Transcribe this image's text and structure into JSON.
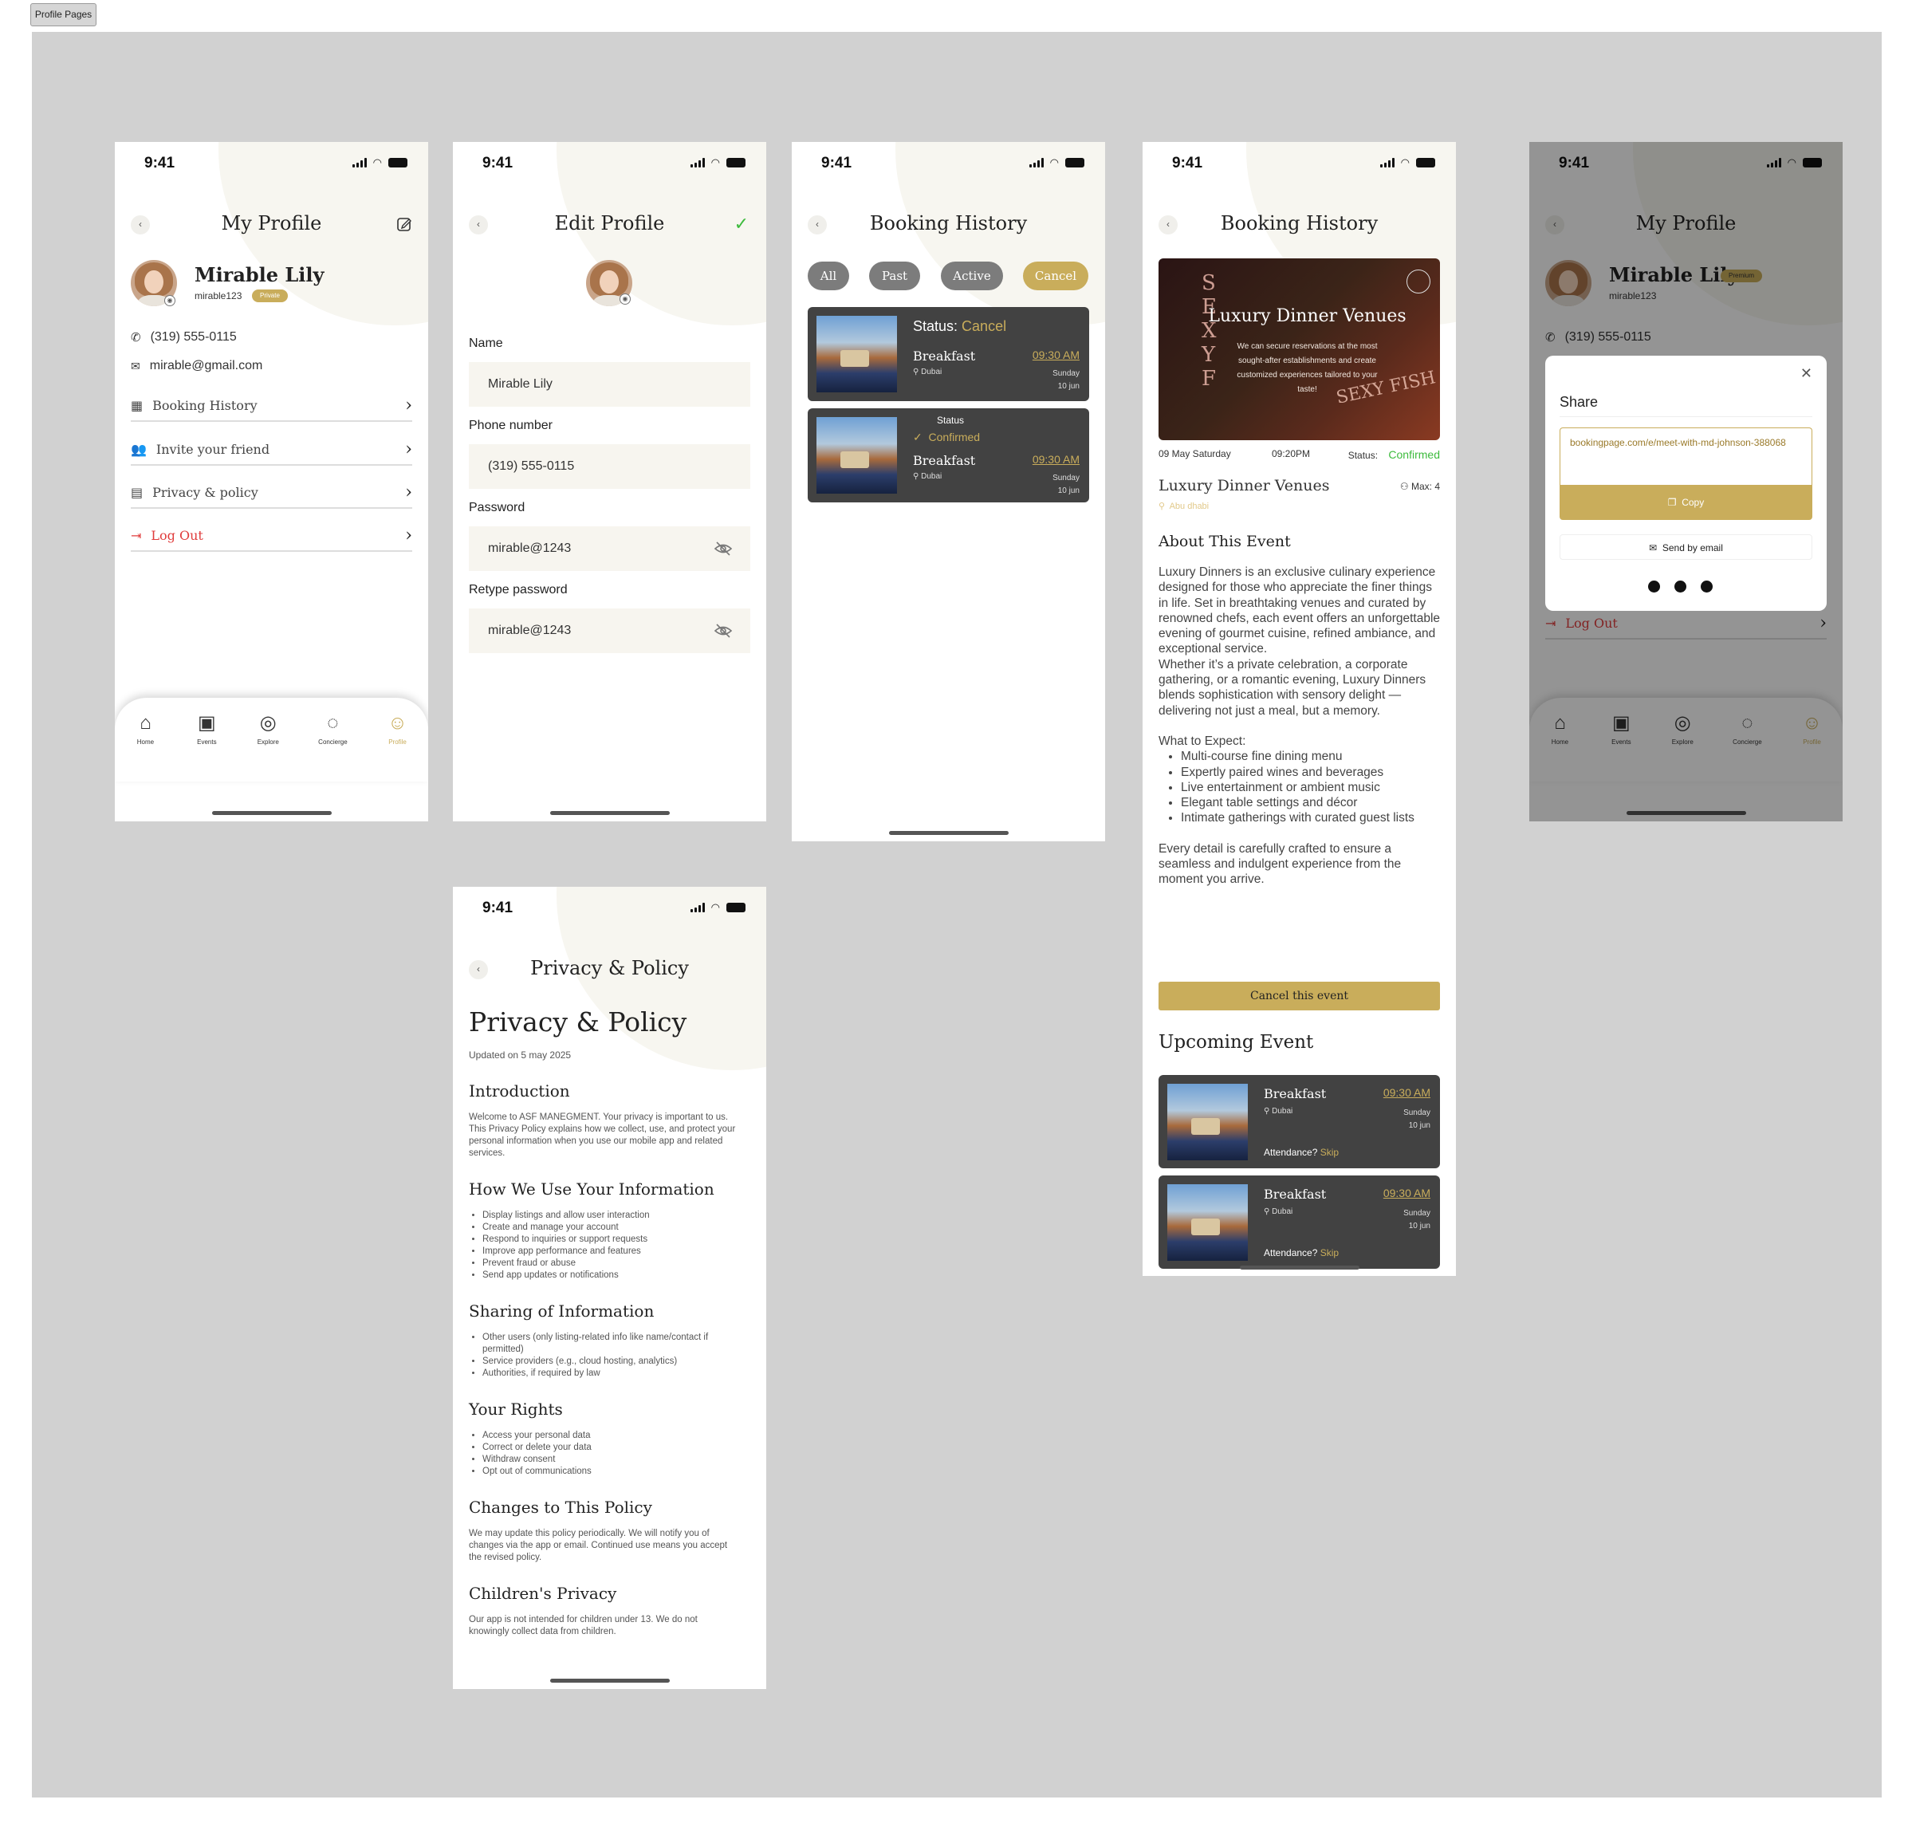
{
  "page_label": "Profile Pages",
  "status_time": "9:41",
  "accent": "#c9ad5b",
  "nav": {
    "home": "Home",
    "events": "Events",
    "explore": "Explore",
    "concierge": "Concierge",
    "profile": "Profile"
  },
  "my_profile": {
    "title": "My Profile",
    "name": "Mirable Lily",
    "username": "mirable123",
    "badge": "Private",
    "phone": "(319) 555-0115",
    "email": "mirable@gmail.com",
    "menu": [
      {
        "label": "Booking History",
        "icon": "calendar-icon"
      },
      {
        "label": "Invite your friend",
        "icon": "add-user-icon"
      },
      {
        "label": "Privacy & policy",
        "icon": "document-icon"
      },
      {
        "label": "Log Out",
        "icon": "logout-icon",
        "color": "#e03c3c"
      }
    ]
  },
  "edit_profile": {
    "title": "Edit Profile",
    "name_label": "Name",
    "name_value": "Mirable Lily",
    "phone_label": "Phone number",
    "phone_value": "(319) 555-0115",
    "password_label": "Password",
    "password_value": "mirable@1243",
    "retype_label": "Retype password",
    "retype_value": "mirable@1243"
  },
  "booking_list": {
    "title": "Booking History",
    "filters": [
      "All",
      "Past",
      "Active",
      "Cancel"
    ],
    "active_filter": "Cancel",
    "cards": [
      {
        "status_label": "Status:",
        "status": "Cancel",
        "title": "Breakfast",
        "location": "Dubai",
        "time": "09:30 AM",
        "day": "Sunday",
        "date": "10 jun"
      },
      {
        "status_label": "Status",
        "status": "Confirmed",
        "title": "Breakfast",
        "location": "Dubai",
        "time": "09:30 AM",
        "day": "Sunday",
        "date": "10 jun"
      }
    ]
  },
  "booking_detail": {
    "title": "Booking History",
    "hero_title": "Luxury Dinner Venues",
    "hero_sub": "We can secure reservations at the most sought-after establishments and create customized experiences tailored to your taste!",
    "hero_sign_left": "SEXY F",
    "hero_sign_right": "SEXY FISH",
    "date": "09 May Saturday",
    "time": "09:20PM",
    "status_label": "Status:",
    "status": "Confirmed",
    "venue": "Luxury Dinner Venues",
    "max": "Max: 4",
    "location": "Abu dhabi",
    "about_title": "About This Event",
    "about_p1": "Luxury Dinners is an exclusive culinary experience designed for those who appreciate the finer things in life. Set in breathtaking venues and curated by renowned chefs, each event offers an unforgettable evening of gourmet cuisine, refined ambiance, and exceptional service.",
    "about_p2": "Whether it’s a private celebration, a corporate gathering, or a romantic evening, Luxury Dinners blends sophistication with sensory delight — delivering not just a meal, but a memory.",
    "expect_title": "What to Expect:",
    "expect": [
      "Multi-course fine dining menu",
      "Expertly paired wines and beverages",
      "Live entertainment or ambient music",
      "Elegant table settings and décor",
      "Intimate gatherings with curated guest lists"
    ],
    "closing": "Every detail is carefully crafted to ensure a seamless and indulgent experience from the moment you arrive.",
    "cancel_button": "Cancel this event",
    "upcoming_title": "Upcoming Event",
    "upcoming": [
      {
        "title": "Breakfast",
        "location": "Dubai",
        "time": "09:30 AM",
        "day": "Sunday",
        "date": "10 jun",
        "attendance": "Attendance?",
        "skip": "Skip"
      },
      {
        "title": "Breakfast",
        "location": "Dubai",
        "time": "09:30 AM",
        "day": "Sunday",
        "date": "10 jun",
        "attendance": "Attendance?",
        "skip": "Skip"
      }
    ]
  },
  "share_screen": {
    "title": "My Profile",
    "name": "Mirable Lily",
    "username": "mirable123",
    "badge": "Premium",
    "phone": "(319) 555-0115",
    "logout": "Log Out",
    "modal": {
      "title": "Share",
      "link": "bookingpage.com/e/meet-with-md-johnson-388068",
      "copy": "Copy",
      "email": "Send by email"
    }
  },
  "privacy": {
    "header": "Privacy & Policy",
    "big_title": "Privacy & Policy",
    "updated": "Updated on 5 may 2025",
    "intro_title": "Introduction",
    "intro_text": "Welcome to ASF MANEGMENT. Your privacy is important to us. This Privacy Policy explains how we collect, use, and protect your personal information when you use our mobile app and related services.",
    "use_title": "How We Use Your Information",
    "use_items": [
      "Display listings and allow user interaction",
      "Create and manage your account",
      "Respond to inquiries or support requests",
      "Improve app performance and features",
      "Prevent fraud or abuse",
      "Send app updates or notifications"
    ],
    "sharing_title": "Sharing of Information",
    "sharing_items": [
      "Other users (only listing-related info like name/contact if permitted)",
      "Service providers (e.g., cloud hosting, analytics)",
      "Authorities, if required by law"
    ],
    "rights_title": "Your Rights",
    "rights_items": [
      "Access your personal data",
      "Correct or delete your data",
      "Withdraw consent",
      "Opt out of communications"
    ],
    "changes_title": "Changes to This Policy",
    "changes_text": "We may update this policy periodically. We will notify you of changes via the app or email. Continued use means you accept the revised policy.",
    "children_title": "Children's Privacy",
    "children_text": "Our app is not intended for children under 13. We do not knowingly collect data from children."
  }
}
